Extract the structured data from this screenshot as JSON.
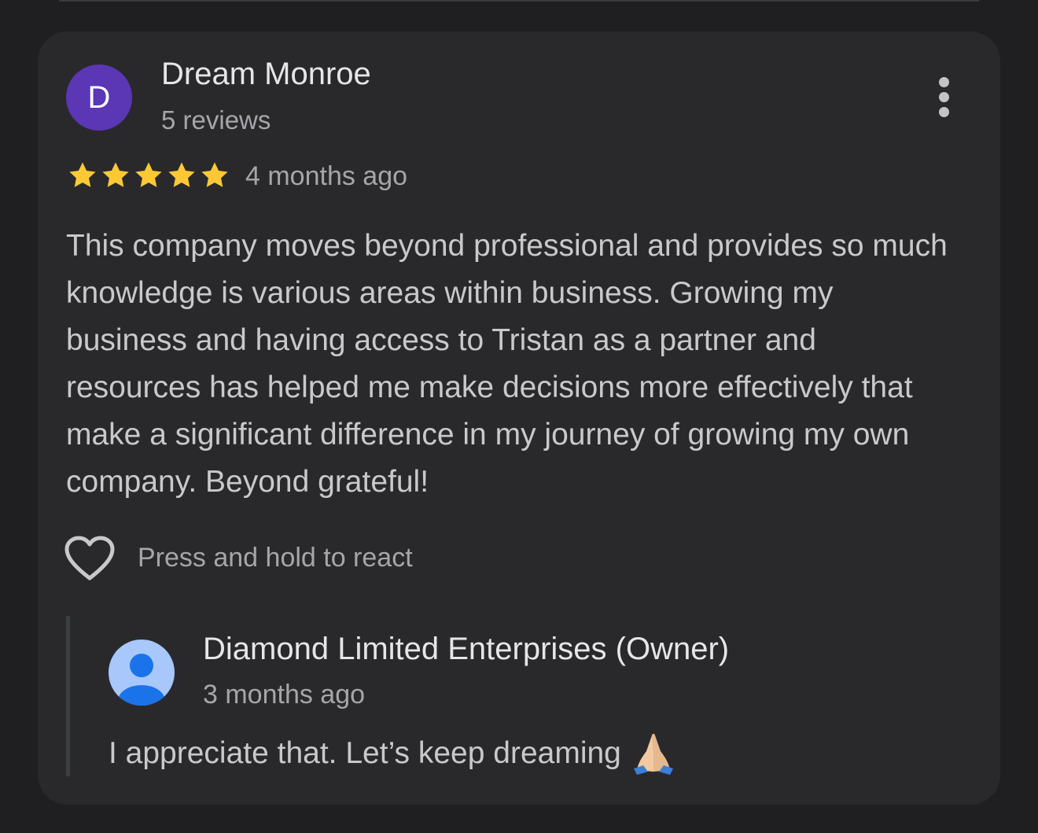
{
  "review": {
    "avatar_letter": "D",
    "author": "Dream Monroe",
    "author_meta": "5 reviews",
    "rating": 5,
    "rating_max": 5,
    "date": "4 months ago",
    "text": "This company moves beyond professional and provides so much knowledge is various areas within business. Growing my business and having access to Tristan as a partner and resources has helped me make decisions more effectively that make a significant difference in my journey of growing my own company. Beyond grateful!",
    "react_hint": "Press and hold to react",
    "colors": {
      "avatar_bg": "#5b36b5",
      "star": "#fcc934",
      "card_bg": "#29292c",
      "page_bg": "#1f1f21"
    }
  },
  "owner_reply": {
    "author": "Diamond Limited Enterprises (Owner)",
    "date": "3 months ago",
    "text": "I appreciate that. Let’s keep dreaming",
    "emoji": "folded-hands-icon",
    "colors": {
      "avatar_bg": "#a8c7fa",
      "avatar_fg": "#1a73e8"
    }
  },
  "icons": {
    "more": "more-vertical-icon",
    "react": "heart-outline-icon",
    "owner_avatar": "default-user-avatar-icon"
  }
}
